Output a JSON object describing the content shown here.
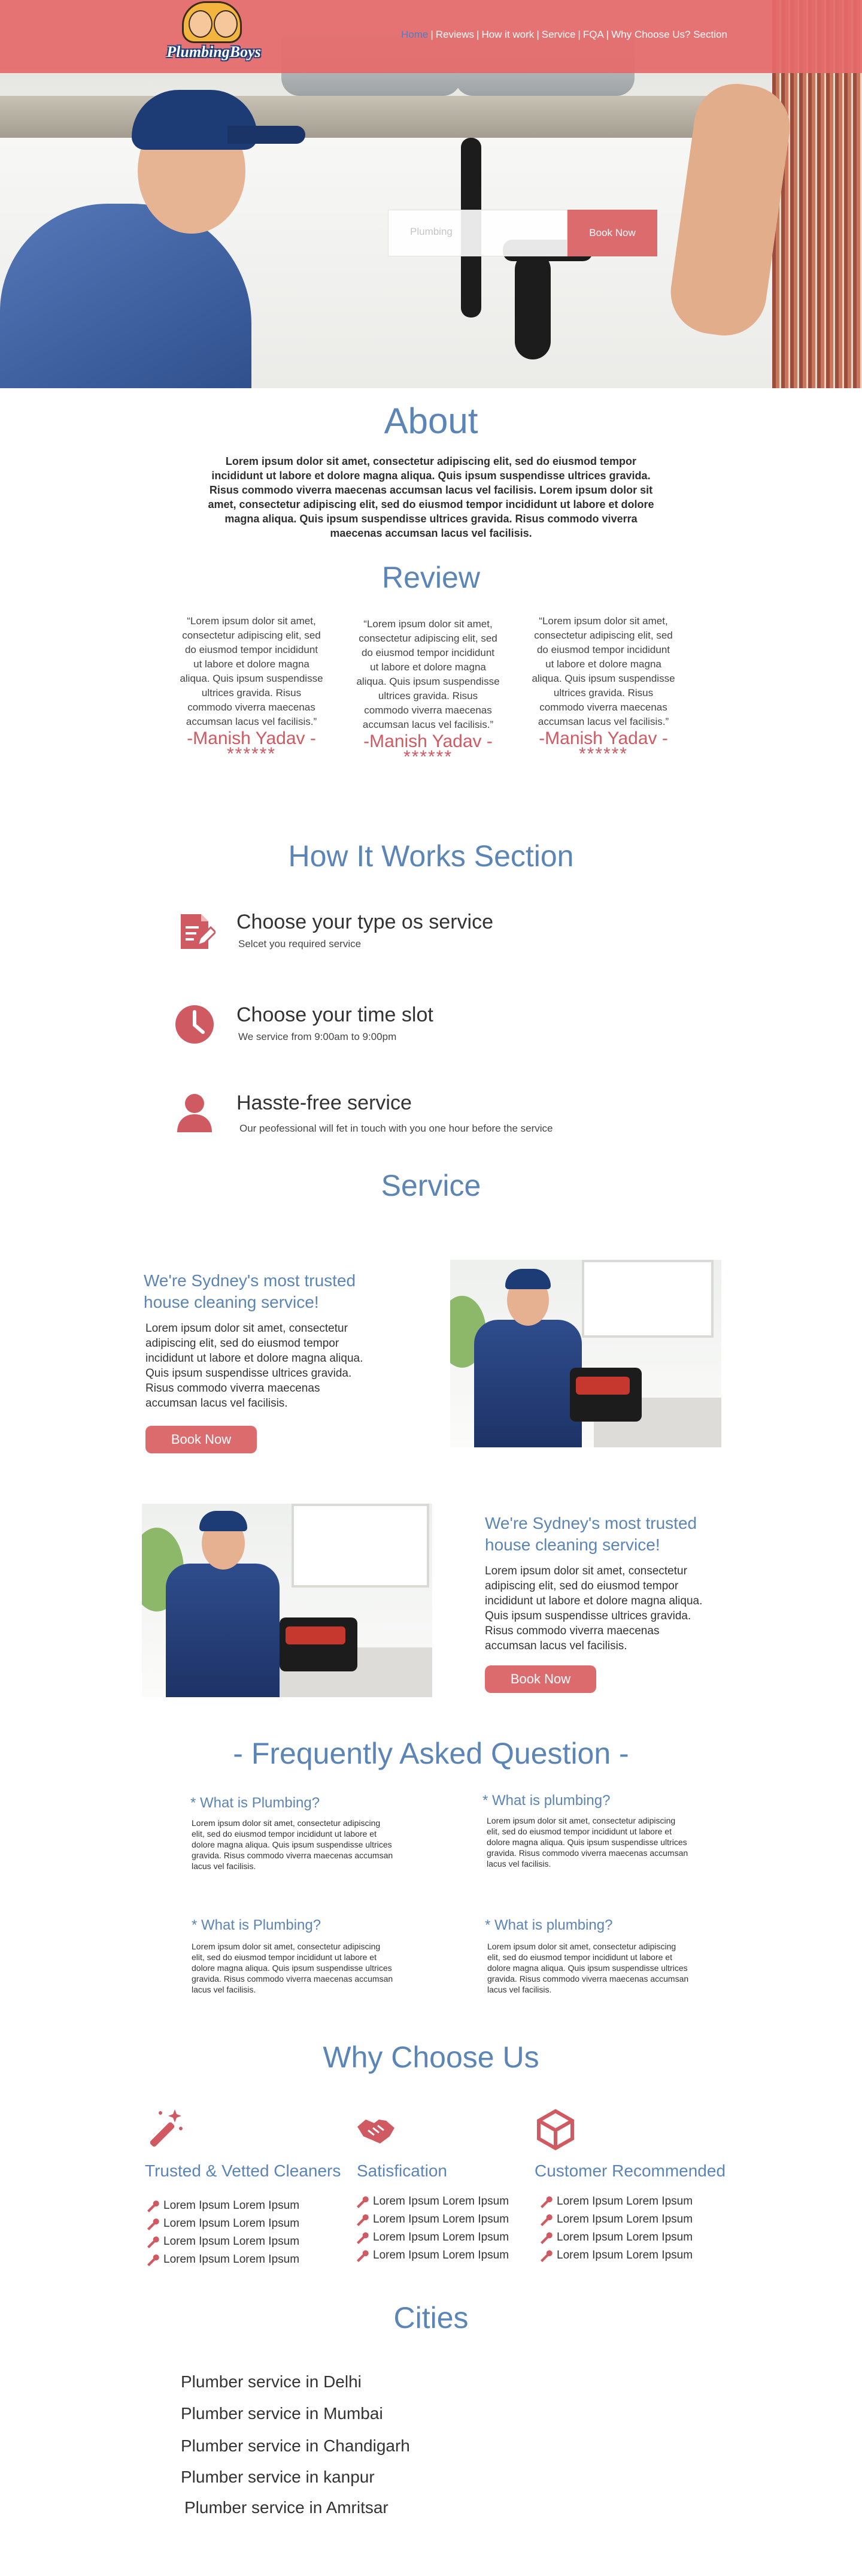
{
  "header": {
    "logo_text": "PlumbingBoys",
    "nav": [
      {
        "label": "Home",
        "active": true
      },
      {
        "label": "Reviews",
        "active": false
      },
      {
        "label": "How it work",
        "active": false
      },
      {
        "label": "Service",
        "active": false
      },
      {
        "label": "FQA",
        "active": false
      },
      {
        "label": "Why Choose Us? Section",
        "active": false
      }
    ],
    "nav_separator": "|",
    "search_placeholder": "Plumbing",
    "book_button": "Book Now"
  },
  "about": {
    "title": "About",
    "text": "Lorem ipsum dolor sit amet, consectetur adipiscing elit, sed do eiusmod tempor incididunt ut labore et dolore magna aliqua. Quis ipsum suspendisse ultrices gravida. Risus commodo viverra maecenas accumsan lacus vel facilisis. Lorem ipsum dolor sit amet, consectetur adipiscing elit, sed do eiusmod tempor incididunt ut labore et dolore magna aliqua. Quis ipsum suspendisse ultrices gravida. Risus commodo viverra maecenas accumsan lacus vel facilisis."
  },
  "review": {
    "title": "Review",
    "items": [
      {
        "quote": "“Lorem ipsum dolor sit amet, consectetur adipiscing elit, sed do eiusmod tempor incididunt ut labore et dolore magna aliqua. Quis ipsum suspendisse ultrices gravida. Risus commodo viverra maecenas accumsan lacus vel facilisis.”",
        "name": "-Manish Yadav -",
        "stars": "******"
      },
      {
        "quote": "“Lorem ipsum dolor sit amet, consectetur adipiscing elit, sed do eiusmod tempor incididunt ut labore et dolore magna aliqua. Quis ipsum suspendisse ultrices gravida. Risus commodo viverra maecenas accumsan lacus vel facilisis.”",
        "name": "-Manish Yadav -",
        "stars": "******"
      },
      {
        "quote": "“Lorem ipsum dolor sit amet, consectetur adipiscing elit, sed do eiusmod tempor incididunt ut labore et dolore magna aliqua. Quis ipsum suspendisse ultrices gravida. Risus commodo viverra maecenas accumsan lacus vel facilisis.”",
        "name": "-Manish Yadav -",
        "stars": "******"
      }
    ]
  },
  "how": {
    "title": "How It Works Section",
    "steps": [
      {
        "icon": "document-edit-icon",
        "title": "Choose your type os service",
        "subtitle": "Selcet you required service"
      },
      {
        "icon": "clock-icon",
        "title": "Choose your time slot",
        "subtitle": "We service from 9:00am to 9:00pm"
      },
      {
        "icon": "user-icon",
        "title": "Hasste-free service",
        "subtitle": "Our peofessional will fet in touch with you one hour before the service"
      }
    ]
  },
  "service": {
    "title": "Service",
    "blocks": [
      {
        "heading": "We're Sydney's most trusted house cleaning service!",
        "body": "Lorem ipsum dolor sit amet, consectetur adipiscing elit, sed do eiusmod tempor incididunt ut labore et dolore magna aliqua. Quis ipsum suspendisse ultrices gravida. Risus commodo viverra maecenas accumsan lacus vel facilisis.",
        "button": "Book Now"
      },
      {
        "heading": "We're Sydney's most trusted house cleaning service!",
        "body": "Lorem ipsum dolor sit amet, consectetur adipiscing elit, sed do eiusmod tempor incididunt ut labore et dolore magna aliqua. Quis ipsum suspendisse ultrices gravida. Risus commodo viverra maecenas accumsan lacus vel facilisis.",
        "button": "Book Now"
      }
    ]
  },
  "faq": {
    "title": "- Frequently Asked Question -",
    "items": [
      {
        "q": "* What is Plumbing?",
        "a": "Lorem ipsum dolor sit amet, consectetur adipiscing elit, sed do eiusmod tempor incididunt ut labore et dolore magna aliqua. Quis ipsum suspendisse ultrices gravida. Risus commodo viverra maecenas accumsan lacus vel facilisis."
      },
      {
        "q": "* What is plumbing?",
        "a": "Lorem ipsum dolor sit amet, consectetur adipiscing elit, sed do eiusmod tempor incididunt ut labore et dolore magna aliqua. Quis ipsum suspendisse ultrices gravida. Risus commodo viverra maecenas accumsan lacus vel facilisis."
      },
      {
        "q": "* What is Plumbing?",
        "a": "Lorem ipsum dolor sit amet, consectetur adipiscing elit, sed do eiusmod tempor incididunt ut labore et dolore magna aliqua. Quis ipsum suspendisse ultrices gravida. Risus commodo viverra maecenas accumsan lacus vel facilisis."
      },
      {
        "q": "* What is plumbing?",
        "a": "Lorem ipsum dolor sit amet, consectetur adipiscing elit, sed do eiusmod tempor incididunt ut labore et dolore magna aliqua. Quis ipsum suspendisse ultrices gravida. Risus commodo viverra maecenas accumsan lacus vel facilisis."
      }
    ]
  },
  "why": {
    "title": "Why Choose Us",
    "columns": [
      {
        "icon": "magic-wand-icon",
        "title": "Trusted & Vetted Cleaners",
        "items": [
          "Lorem Ipsum Lorem Ipsum",
          "Lorem Ipsum Lorem Ipsum",
          "Lorem Ipsum Lorem Ipsum",
          "Lorem Ipsum Lorem Ipsum"
        ]
      },
      {
        "icon": "handshake-icon",
        "title": "Satisfication",
        "items": [
          "Lorem Ipsum Lorem Ipsum",
          "Lorem Ipsum Lorem Ipsum",
          "Lorem Ipsum Lorem Ipsum",
          "Lorem Ipsum Lorem Ipsum"
        ]
      },
      {
        "icon": "cube-icon",
        "title": "Customer Recommended",
        "items": [
          "Lorem Ipsum Lorem Ipsum",
          "Lorem Ipsum Lorem Ipsum",
          "Lorem Ipsum Lorem Ipsum",
          "Lorem Ipsum Lorem Ipsum"
        ]
      }
    ]
  },
  "cities": {
    "title": "Cities",
    "items": [
      "Plumber service in Delhi",
      "Plumber service in Mumbai",
      "Plumber service in Chandigarh",
      "Plumber service in kanpur",
      "Plumber service in Amritsar"
    ]
  },
  "colors": {
    "accent_blue": "#5b84b7",
    "accent_red": "#d05a62",
    "header_red": "#e56a6a"
  }
}
